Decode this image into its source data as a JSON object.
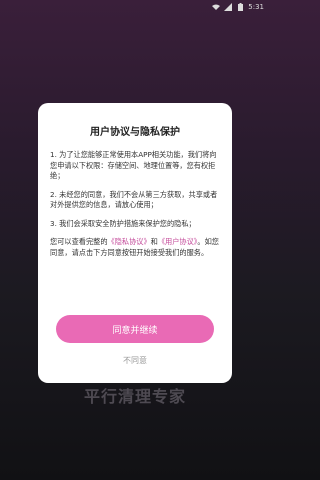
{
  "status_bar": {
    "time": "5:31",
    "icons": [
      "wifi-icon",
      "signal-icon",
      "battery-icon"
    ]
  },
  "background": {
    "app_title": "平行清理专家"
  },
  "dialog": {
    "title": "用户协议与隐私保护",
    "para1": "1. 为了让您能够正常使用本APP相关功能，我们将向您申请以下权限：存储空间、地理位置等，您有权拒绝；",
    "para2": "2. 未经您的同意，我们不会从第三方获取，共享或者对外提供您的信息，请放心使用；",
    "para3": "3. 我们会采取安全防护措施来保护您的隐私；",
    "para4_prefix": "您可以查看完整的",
    "privacy_link": "《隐私协议》",
    "para4_and": "和",
    "user_link": "《用户协议》",
    "para4_suffix": "。如您同意，请点击下方同意按钮开始接受我们的服务。",
    "agree_label": "同意并继续",
    "disagree_label": "不同意"
  },
  "colors": {
    "accent": "#e96ab5",
    "link": "#c44a9a"
  }
}
